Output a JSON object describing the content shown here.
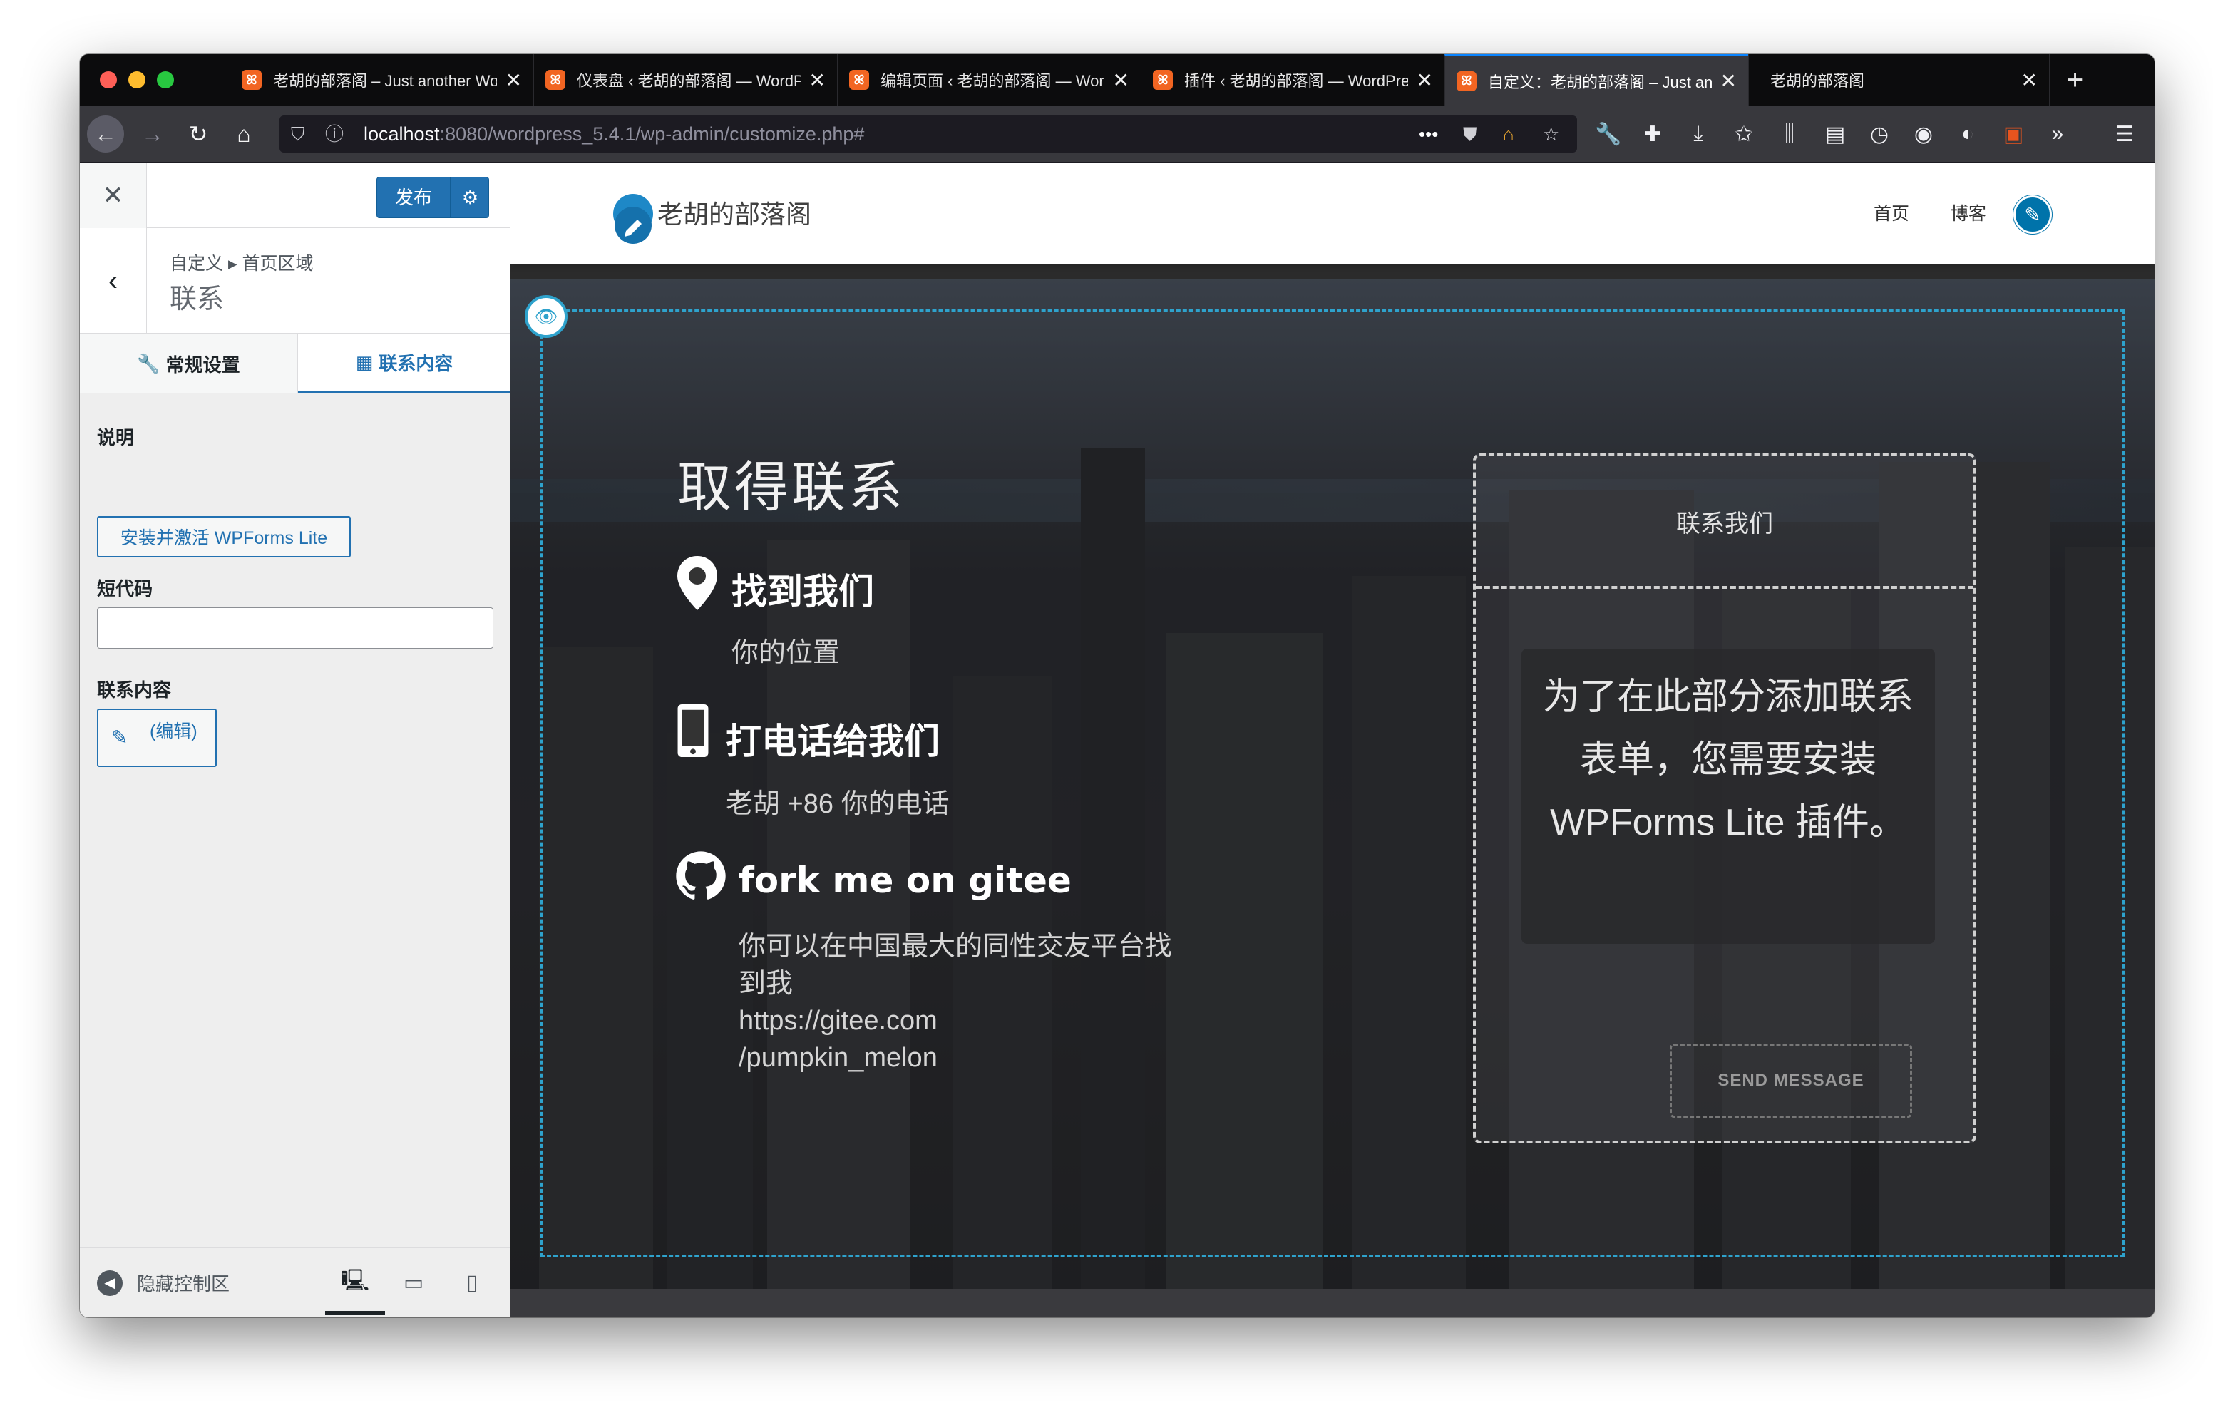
{
  "browser": {
    "tabs": [
      {
        "label": "老胡的部落阁 – Just another WordPress site",
        "icon": "xampp-icon"
      },
      {
        "label": "仪表盘 ‹ 老胡的部落阁 — WordPress",
        "icon": "xampp-icon"
      },
      {
        "label": "编辑页面 ‹ 老胡的部落阁 — WordPress",
        "icon": "xampp-icon"
      },
      {
        "label": "插件 ‹ 老胡的部落阁 — WordPress",
        "icon": "xampp-icon"
      },
      {
        "label": "自定义：老胡的部落阁 – Just another WordPress site",
        "icon": "xampp-icon",
        "active": true
      },
      {
        "label": "老胡的部落阁",
        "icon": ""
      }
    ],
    "url_host": "localhost",
    "url_path": ":8080/wordpress_5.4.1/wp-admin/customize.php#",
    "url_more": "•••"
  },
  "customizer": {
    "publish_label": "发布",
    "breadcrumb": "自定义 ▸ 首页区域",
    "section_title": "联系",
    "tab_general": "常规设置",
    "tab_content": "联系内容",
    "label_description": "说明",
    "install_button": "安装并激活 WPForms Lite",
    "label_shortcode": "短代码",
    "shortcode_value": "",
    "label_contact_content": "联系内容",
    "edit_link": "(编辑)",
    "hide_controls": "隐藏控制区"
  },
  "site": {
    "logo_text": "老胡的部落阁",
    "menu": [
      "首页",
      "博客"
    ],
    "contact_title": "取得联系",
    "items": [
      {
        "heading": "找到我们",
        "text": "你的位置",
        "icon": "map-pin-icon"
      },
      {
        "heading": "打电话给我们",
        "text": "老胡 +86 你的电话",
        "icon": "phone-icon"
      },
      {
        "heading": "fork me on gitee",
        "text": "你可以在中国最大的同性交友平台找到我 https://gitee.com/pumpkin_melon",
        "icon": "github-icon"
      }
    ],
    "item3_line1": "你可以在中国最大的同性交友平台找",
    "item3_line2": "到我",
    "item3_line3": "https://gitee.com",
    "item3_line4": "/pumpkin_melon",
    "form_title": "联系我们",
    "form_message": "为了在此部分添加联系表单，您需要安装 WPForms Lite 插件。",
    "send_label": "SEND MESSAGE"
  },
  "colors": {
    "wp_blue": "#2271b1",
    "focus_dash": "#2ea2cc",
    "titlebar": "#0c0c0d",
    "toolbar": "#38383d"
  }
}
